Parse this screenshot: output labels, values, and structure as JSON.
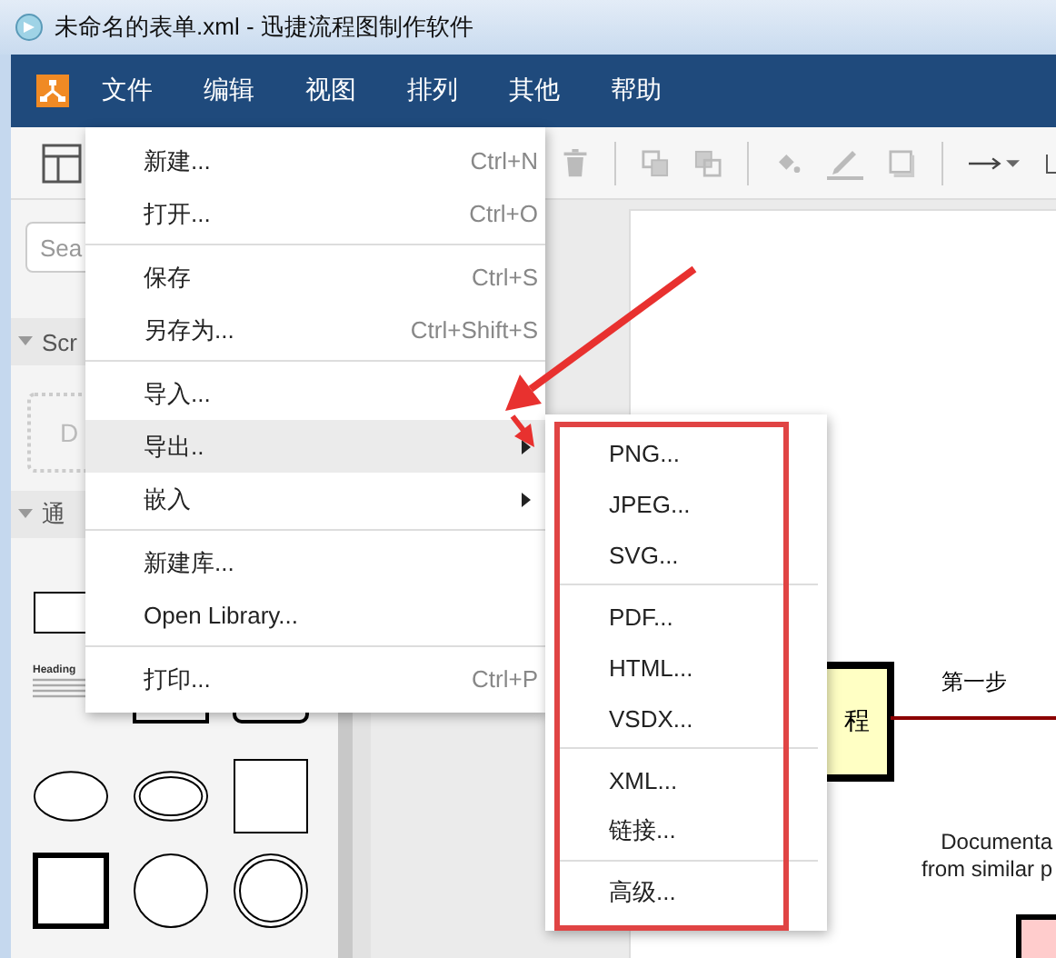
{
  "window": {
    "title": "未命名的表单.xml - 迅捷流程图制作软件"
  },
  "menubar": [
    {
      "label": "文件"
    },
    {
      "label": "编辑"
    },
    {
      "label": "视图"
    },
    {
      "label": "排列"
    },
    {
      "label": "其他"
    },
    {
      "label": "帮助"
    }
  ],
  "sidebar": {
    "search": {
      "placeholder": "Sea"
    },
    "sections": [
      {
        "title": "Scr",
        "expanded": true
      },
      {
        "title": "通",
        "expanded": true
      }
    ],
    "scratchpad_hint": "D",
    "heading_shape": "Heading"
  },
  "file_menu": [
    {
      "kind": "item",
      "label": "新建...",
      "shortcut": "Ctrl+N",
      "submenu": false,
      "selected": false
    },
    {
      "kind": "item",
      "label": "打开...",
      "shortcut": "Ctrl+O",
      "submenu": false,
      "selected": false
    },
    {
      "kind": "separator"
    },
    {
      "kind": "item",
      "label": "保存",
      "shortcut": "Ctrl+S",
      "submenu": false,
      "selected": false
    },
    {
      "kind": "item",
      "label": "另存为...",
      "shortcut": "Ctrl+Shift+S",
      "submenu": false,
      "selected": false
    },
    {
      "kind": "separator"
    },
    {
      "kind": "item",
      "label": "导入...",
      "submenu": false,
      "selected": false
    },
    {
      "kind": "item",
      "label": "导出..",
      "submenu": true,
      "selected": true
    },
    {
      "kind": "item",
      "label": "嵌入",
      "submenu": true,
      "selected": false
    },
    {
      "kind": "separator"
    },
    {
      "kind": "item",
      "label": "新建库...",
      "submenu": false,
      "selected": false
    },
    {
      "kind": "item",
      "label": "Open Library...",
      "submenu": false,
      "selected": false
    },
    {
      "kind": "separator"
    },
    {
      "kind": "item",
      "label": "打印...",
      "shortcut": "Ctrl+P",
      "submenu": false,
      "selected": false
    }
  ],
  "export_menu": [
    {
      "kind": "item",
      "label": "PNG..."
    },
    {
      "kind": "item",
      "label": "JPEG..."
    },
    {
      "kind": "item",
      "label": "SVG..."
    },
    {
      "kind": "separator"
    },
    {
      "kind": "item",
      "label": "PDF..."
    },
    {
      "kind": "item",
      "label": "HTML..."
    },
    {
      "kind": "item",
      "label": "VSDX..."
    },
    {
      "kind": "separator"
    },
    {
      "kind": "item",
      "label": "XML..."
    },
    {
      "kind": "item",
      "label": "链接..."
    },
    {
      "kind": "separator"
    },
    {
      "kind": "item",
      "label": "高级..."
    }
  ],
  "canvas": {
    "process_label": "程",
    "edge_label": "第一步",
    "note_lines": [
      "Documenta",
      "from similar p"
    ]
  }
}
